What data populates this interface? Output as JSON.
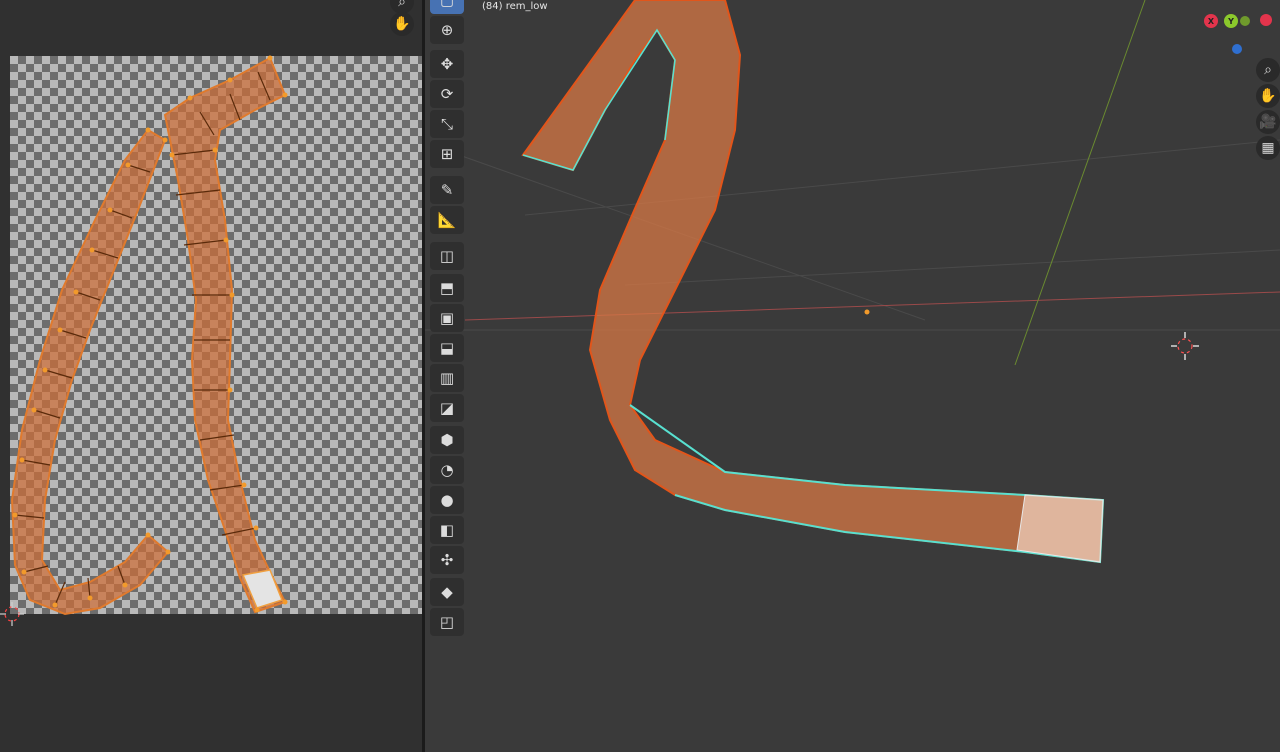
{
  "viewport": {
    "object_label": "(84) rem_low"
  },
  "gizmo": {
    "x_label": "X",
    "y_label": "Y",
    "colors": {
      "x": "#e3344c",
      "y": "#8bc92c",
      "z": "#2f83e6"
    }
  },
  "icons": {
    "uv_zoom": "zoom-icon",
    "uv_pan": "hand-icon",
    "toolbar": [
      "select-box-icon",
      "cursor-icon",
      "move-icon",
      "rotate-icon",
      "scale-icon",
      "transform-icon",
      "annotate-icon",
      "measure-icon",
      "add-cube-icon",
      "extrude-icon",
      "inset-icon",
      "bevel-icon",
      "loop-cut-icon",
      "knife-icon",
      "poly-build-icon",
      "spin-icon",
      "smooth-icon",
      "edge-slide-icon",
      "shrink-fatten-icon",
      "shear-icon",
      "rip-icon"
    ],
    "nav": [
      "zoom-icon",
      "hand-icon",
      "camera-icon",
      "grid-icon"
    ]
  },
  "colors": {
    "mesh_orange": "#e0783a",
    "selection_teal": "#58e0d0",
    "active_tool": "#4772b3"
  }
}
